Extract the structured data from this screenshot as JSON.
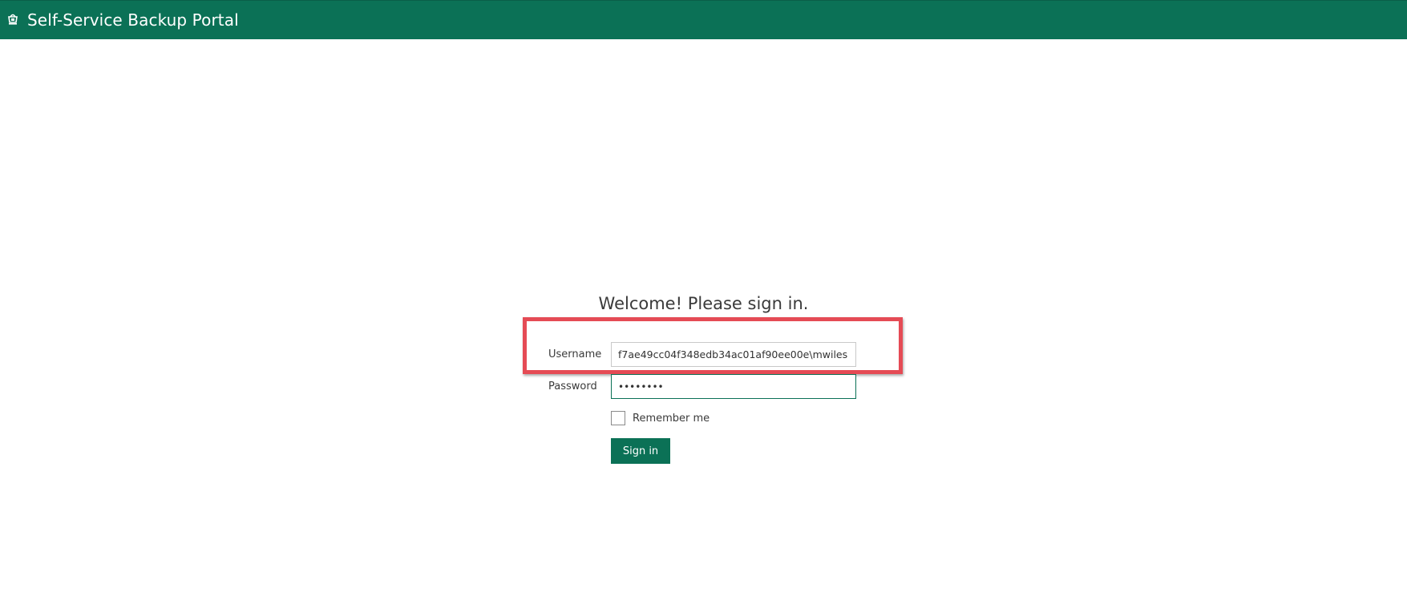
{
  "header": {
    "title": "Self-Service Backup Portal",
    "logo_icon": "portal-logo-icon",
    "background_color": "#0b7156"
  },
  "login": {
    "heading": "Welcome! Please sign in.",
    "username_label": "Username",
    "username_value": "f7ae49cc04f348edb34ac01af90ee00e\\mwiles",
    "password_label": "Password",
    "password_value": "••••••••",
    "remember_label": "Remember me",
    "remember_checked": false,
    "signin_label": "Sign in"
  },
  "annotation": {
    "highlight_color": "#e54b55"
  }
}
